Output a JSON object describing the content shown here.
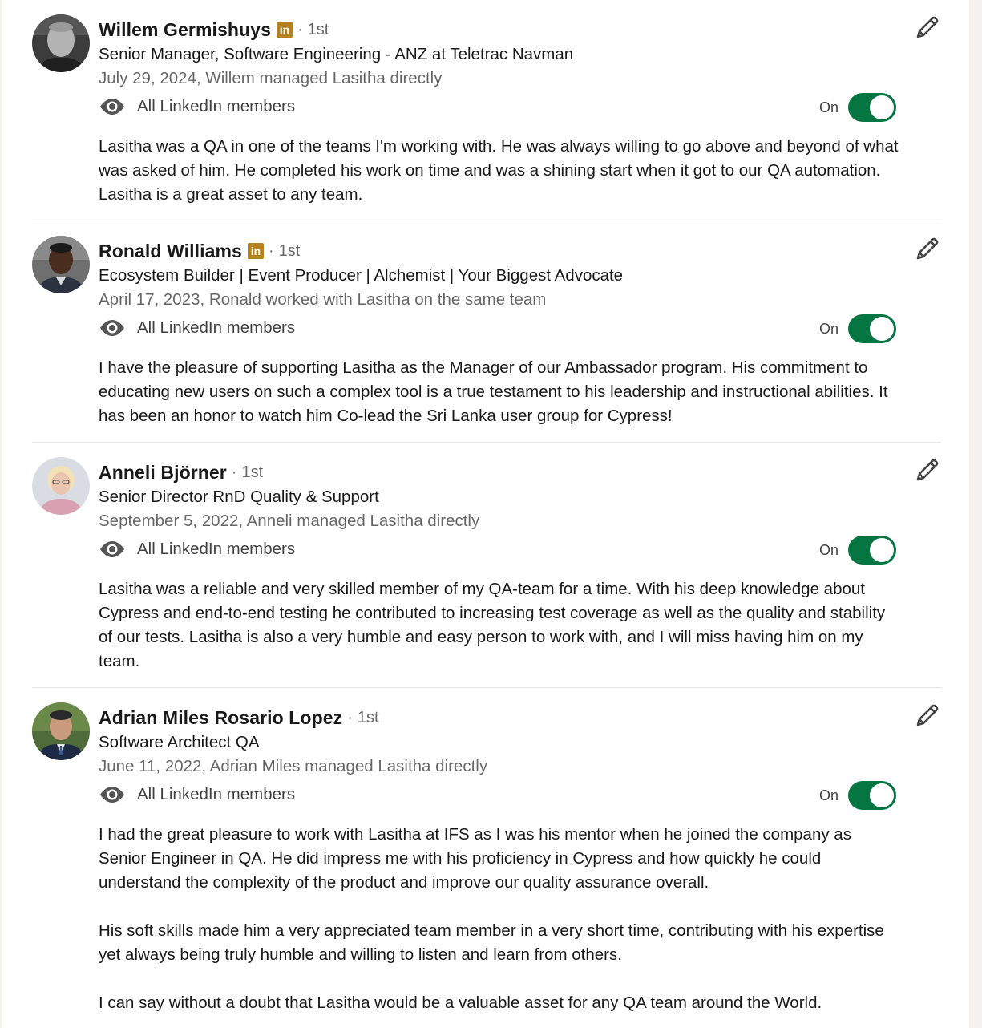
{
  "recommendations": [
    {
      "name": "Willem Germishuys",
      "has_premium_badge": true,
      "badge_text": "in",
      "degree": "1st",
      "headline": "Senior Manager, Software Engineering - ANZ at Teletrac Navman",
      "date_relation": "July 29, 2024, Willem managed Lasitha directly",
      "visibility": "All LinkedIn members",
      "toggle_label": "On",
      "toggle_on": true,
      "paragraphs": [
        "Lasitha was a QA in one of the teams I'm working with. He was always willing to go above and beyond of what was asked of him. He completed his work on time and was a shining start when it got to our QA automation. Lasitha is a great asset to any team."
      ]
    },
    {
      "name": "Ronald Williams",
      "has_premium_badge": true,
      "badge_text": "in",
      "degree": "1st",
      "headline": "Ecosystem Builder | Event Producer | Alchemist | Your Biggest Advocate",
      "date_relation": "April 17, 2023, Ronald worked with Lasitha on the same team",
      "visibility": "All LinkedIn members",
      "toggle_label": "On",
      "toggle_on": true,
      "paragraphs": [
        "I have the pleasure of supporting Lasitha as the Manager of our Ambassador program. His commitment to educating new users on such a complex tool is a true testament to his leadership and instructional abilities. It has been an honor to watch him Co-lead the Sri Lanka user group for Cypress!"
      ]
    },
    {
      "name": "Anneli Björner",
      "has_premium_badge": false,
      "degree": "1st",
      "headline": "Senior Director RnD Quality & Support",
      "date_relation": "September 5, 2022, Anneli managed Lasitha directly",
      "visibility": "All LinkedIn members",
      "toggle_label": "On",
      "toggle_on": true,
      "paragraphs": [
        "Lasitha was a reliable and very skilled member of my QA-team for a time. With his deep knowledge about Cypress and end-to-end testing he contributed to increasing test coverage as well as the quality and stability of our tests. Lasitha is also a very humble and easy person to work with, and I will miss having him on my team."
      ]
    },
    {
      "name": "Adrian Miles Rosario Lopez",
      "has_premium_badge": false,
      "degree": "1st",
      "headline": "Software Architect QA",
      "date_relation": "June 11, 2022, Adrian Miles managed Lasitha directly",
      "visibility": "All LinkedIn members",
      "toggle_label": "On",
      "toggle_on": true,
      "paragraphs": [
        "I had the great pleasure to work with Lasitha at IFS as I was his mentor when he joined the company as Senior Engineer in QA. He did impress me with his proficiency in Cypress and how quickly he could understand the complexity of the product and improve our quality assurance overall.",
        "His soft skills made him a very appreciated team member in a very short time, contributing with his expertise yet always being truly humble and willing to listen and learn from others.",
        "I can say without a doubt that Lasitha would be a valuable asset for any QA team around the World."
      ]
    }
  ],
  "colors": {
    "toggle_on": "#057642",
    "premium_badge": "#b5811f",
    "secondary_text": "#666666"
  },
  "icons": {
    "edit": "pencil-icon",
    "visibility": "eye-icon",
    "premium": "linkedin-premium-badge-icon"
  }
}
